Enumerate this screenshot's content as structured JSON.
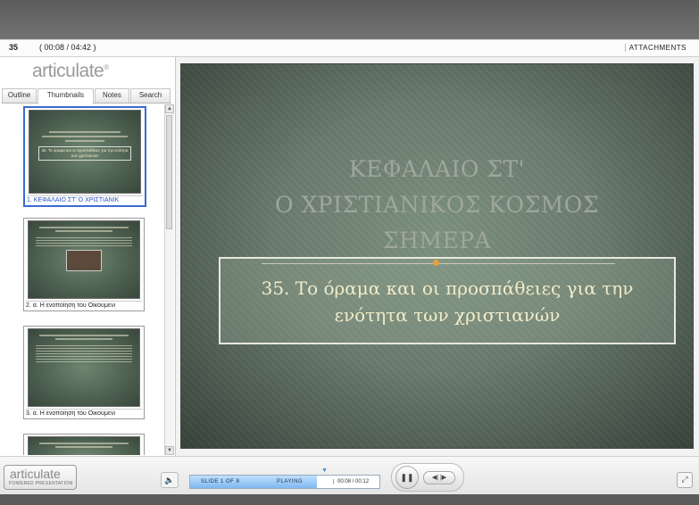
{
  "header": {
    "slide_number": "35",
    "time": "( 00:08 / 04:42 )",
    "attachments_label": "ATTACHMENTS"
  },
  "sidebar": {
    "logo": "articulate",
    "logo_mark": "®",
    "tabs": [
      {
        "label": "Outline"
      },
      {
        "label": "Thumbnails"
      },
      {
        "label": "Notes"
      },
      {
        "label": "Search"
      }
    ],
    "thumbnails": [
      {
        "caption": "1. ΚΕΦΑΛΑΙΟ ΣΤ' Ο ΧΡΙΣΤΙΑΝΙΚ",
        "image_text": "35. Το όραμα και οι προσπάθειες για την ενότητα των χριστιανών",
        "selected": true
      },
      {
        "caption": "2. α. Η ενοποίηση του Οικουμενι",
        "selected": false
      },
      {
        "caption": "3. α. Η ενοποίηση του Οικουμενι",
        "selected": false
      }
    ]
  },
  "slide": {
    "title_lines": [
      "ΚΕΦΑΛΑΙΟ ΣΤ'",
      "Ο ΧΡΙΣΤΙΑΝΙΚΟΣ ΚΟΣΜΟΣ",
      "ΣΗΜΕΡΑ"
    ],
    "subtitle_lines": [
      "35. Το όραμα και οι προσπάθειες για την",
      "ενότητα των χριστιανών"
    ]
  },
  "controls": {
    "badge_logo": "articulate",
    "badge_sub": "POWERED PRESENTATION",
    "slide_status": "SLIDE 1 OF 8",
    "play_status": "PLAYING",
    "time": "00:08 / 00:12",
    "progress": 0.67
  },
  "colors": {
    "accent_blue": "#2a54c8",
    "slide_title": "#9fa79c",
    "slide_subtitle": "#f2ecc8",
    "orange_dot": "#e6a23a"
  }
}
